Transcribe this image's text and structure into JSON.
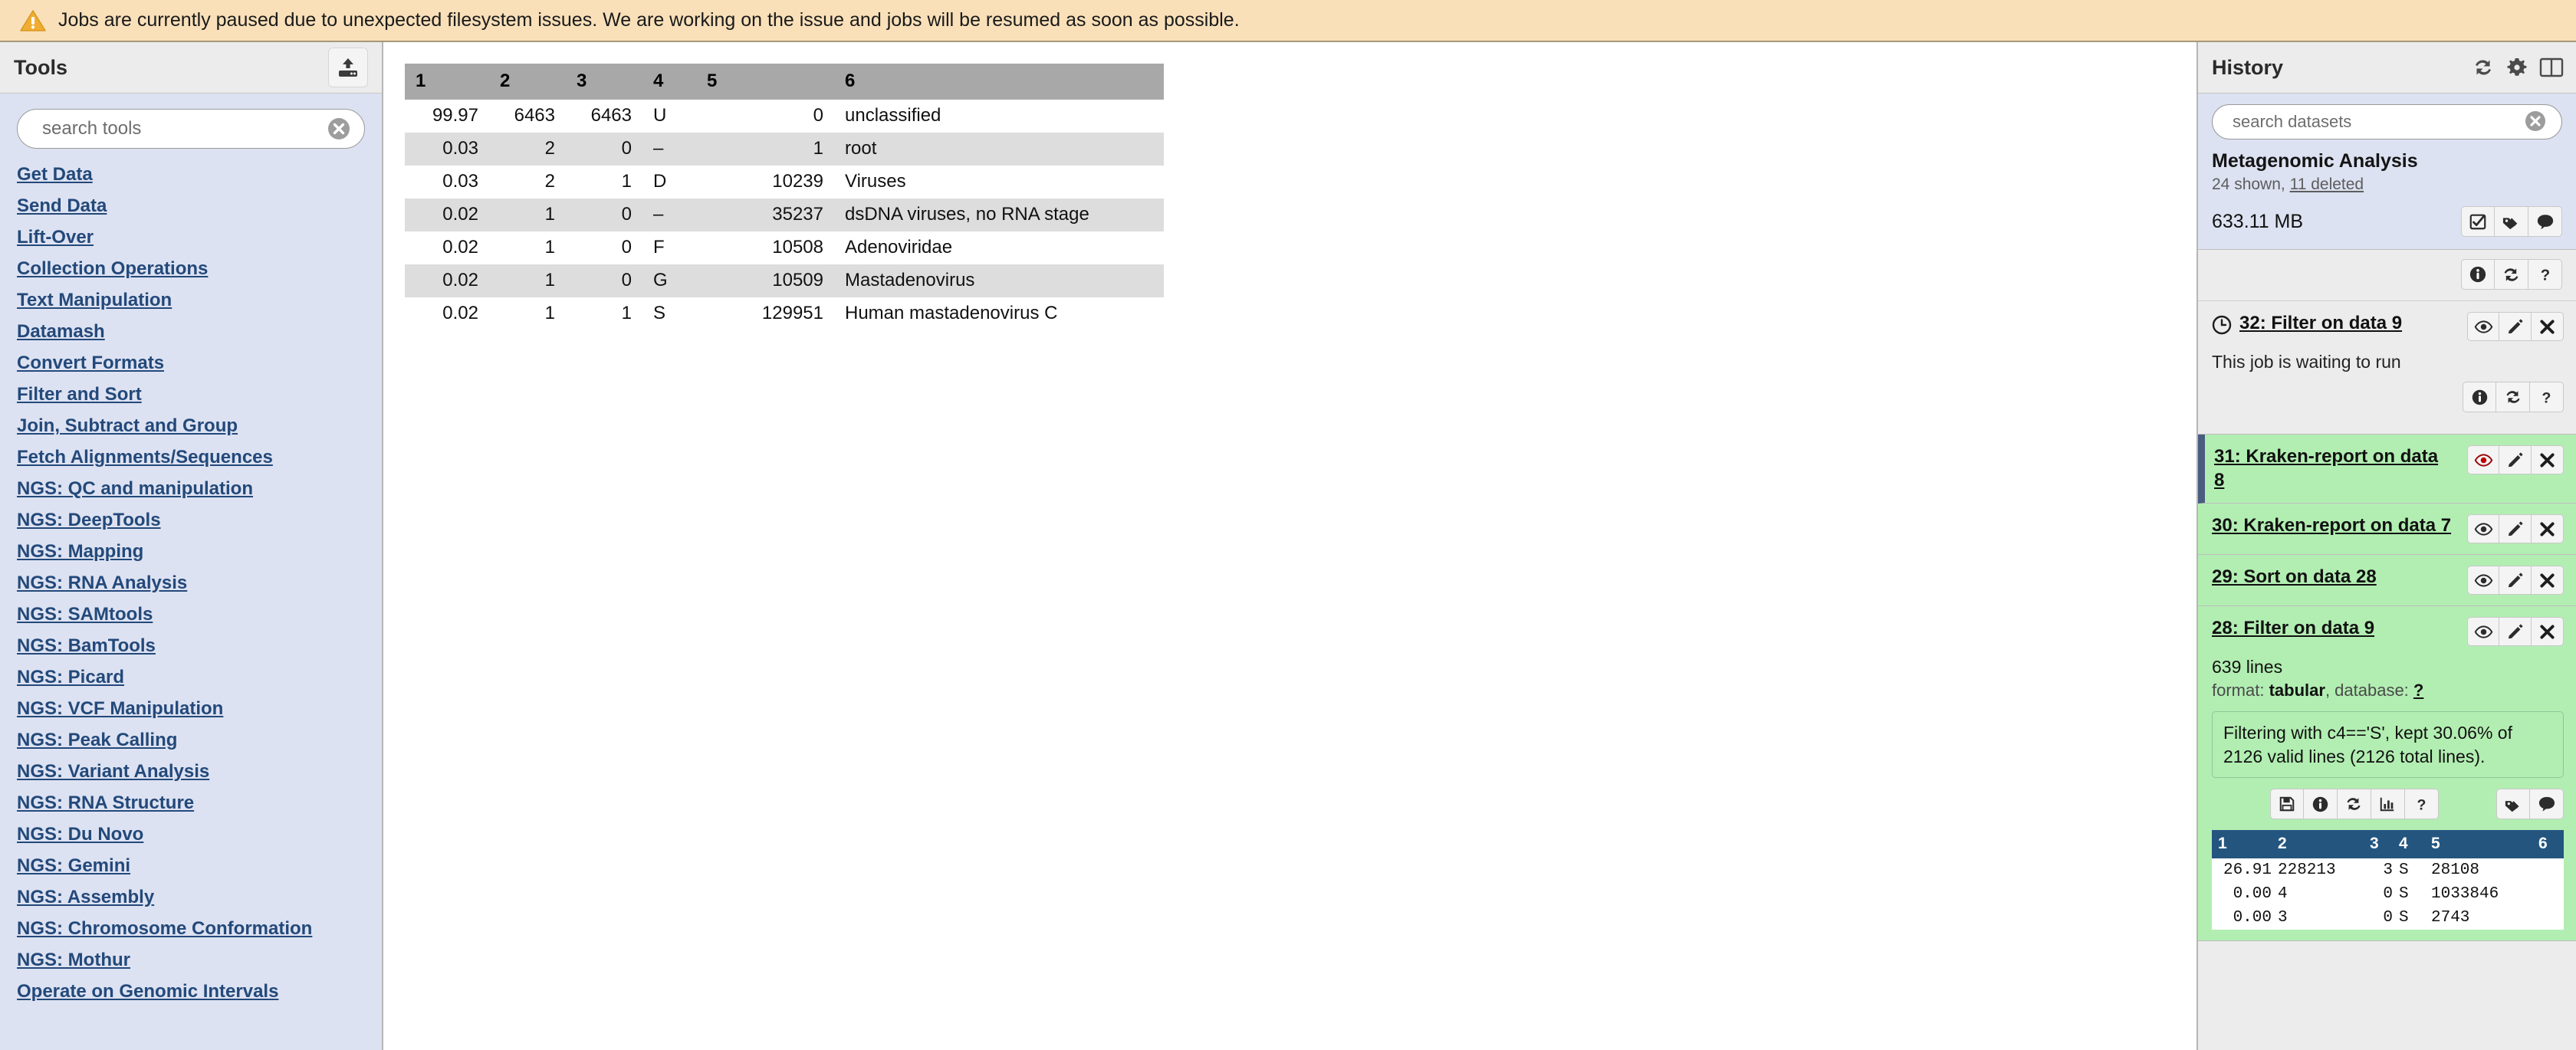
{
  "banner": {
    "icon": "warning-triangle-icon",
    "text": "Jobs are currently paused due to unexpected filesystem issues. We are working on the issue and jobs will be resumed as soon as possible."
  },
  "tools": {
    "title": "Tools",
    "upload_icon": "upload-icon",
    "search": {
      "placeholder": "search tools",
      "value": "",
      "clear_icon": "clear-circle-icon"
    },
    "items": [
      {
        "label": "Get Data"
      },
      {
        "label": "Send Data"
      },
      {
        "label": "Lift-Over"
      },
      {
        "label": "Collection Operations"
      },
      {
        "label": "Text Manipulation"
      },
      {
        "label": "Datamash"
      },
      {
        "label": "Convert Formats"
      },
      {
        "label": "Filter and Sort"
      },
      {
        "label": "Join, Subtract and Group"
      },
      {
        "label": "Fetch Alignments/Sequences"
      },
      {
        "label": "NGS: QC and manipulation"
      },
      {
        "label": "NGS: DeepTools"
      },
      {
        "label": "NGS: Mapping"
      },
      {
        "label": "NGS: RNA Analysis"
      },
      {
        "label": "NGS: SAMtools"
      },
      {
        "label": "NGS: BamTools"
      },
      {
        "label": "NGS: Picard"
      },
      {
        "label": "NGS: VCF Manipulation"
      },
      {
        "label": "NGS: Peak Calling"
      },
      {
        "label": "NGS: Variant Analysis"
      },
      {
        "label": "NGS: RNA Structure"
      },
      {
        "label": "NGS: Du Novo"
      },
      {
        "label": "NGS: Gemini"
      },
      {
        "label": "NGS: Assembly"
      },
      {
        "label": "NGS: Chromosome Conformation"
      },
      {
        "label": "NGS: Mothur"
      },
      {
        "label": "Operate on Genomic Intervals"
      }
    ]
  },
  "dataset": {
    "headers": [
      "1",
      "2",
      "3",
      "4",
      "5",
      "6"
    ],
    "rows": [
      [
        "99.97",
        "6463",
        "6463",
        "U",
        "0",
        "unclassified"
      ],
      [
        "0.03",
        "2",
        "0",
        "–",
        "1",
        "root"
      ],
      [
        "0.03",
        "2",
        "1",
        "D",
        "10239",
        "Viruses"
      ],
      [
        "0.02",
        "1",
        "0",
        "–",
        "35237",
        "dsDNA viruses, no RNA stage"
      ],
      [
        "0.02",
        "1",
        "0",
        "F",
        "10508",
        "Adenoviridae"
      ],
      [
        "0.02",
        "1",
        "0",
        "G",
        "10509",
        "Mastadenovirus"
      ],
      [
        "0.02",
        "1",
        "1",
        "S",
        "129951",
        "Human mastadenovirus C"
      ]
    ]
  },
  "history": {
    "title": "History",
    "header_icons": [
      "refresh-icon",
      "gear-icon",
      "split-columns-icon"
    ],
    "search": {
      "placeholder": "search datasets",
      "value": "",
      "clear_icon": "clear-circle-icon"
    },
    "name": "Metagenomic Analysis",
    "counts_shown": "24 shown, ",
    "counts_deleted": "11 deleted",
    "size": "633.11 MB",
    "summary_icons": [
      "select-checkbox-icon",
      "tags-icon",
      "annotation-icon"
    ],
    "toolbar_icons": [
      "info-icon",
      "refresh-icon",
      "help-icon"
    ],
    "items": [
      {
        "id": "32",
        "title": "32: Filter on data 9",
        "state": "queued",
        "selected": false,
        "has_clock": true,
        "status": "This job is waiting to run",
        "buttons": [
          "display-icon",
          "edit-icon",
          "delete-icon"
        ],
        "action_icons": [
          "info-icon",
          "refresh-icon",
          "help-icon"
        ]
      },
      {
        "id": "31",
        "title": "31: Kraken-report on data 8",
        "state": "ok",
        "selected": true,
        "has_clock": false,
        "buttons": [
          "display-icon",
          "edit-icon",
          "delete-icon"
        ],
        "display_active": true
      },
      {
        "id": "30",
        "title": "30: Kraken-report on data 7",
        "state": "ok",
        "selected": false,
        "has_clock": false,
        "buttons": [
          "display-icon",
          "edit-icon",
          "delete-icon"
        ]
      },
      {
        "id": "29",
        "title": "29: Sort on data 28",
        "state": "ok",
        "selected": false,
        "has_clock": false,
        "buttons": [
          "display-icon",
          "edit-icon",
          "delete-icon"
        ]
      },
      {
        "id": "28",
        "title": "28: Filter on data 9",
        "state": "ok",
        "selected": false,
        "expanded": true,
        "has_clock": false,
        "buttons": [
          "display-icon",
          "edit-icon",
          "delete-icon"
        ],
        "lines": "639 lines",
        "format_prefix": "format: ",
        "format_value": "tabular",
        "format_mid": ", database: ",
        "database_value": "?",
        "blurb": "Filtering with c4=='S', kept 30.06% of 2126 valid lines (2126 total lines).",
        "action_icons": [
          "save-icon",
          "info-icon",
          "refresh-icon",
          "chart-icon",
          "help-icon"
        ],
        "action_icons_right": [
          "tags-icon",
          "annotation-icon"
        ],
        "peek": {
          "headers": [
            "1",
            "2",
            "3",
            "4",
            "5",
            "6"
          ],
          "rows": [
            [
              "26.91",
              "228213",
              "3",
              "S",
              "28108",
              ""
            ],
            [
              "0.00",
              "4",
              "0",
              "S",
              "1033846",
              ""
            ],
            [
              "0.00",
              "3",
              "0",
              "S",
              "2743",
              ""
            ]
          ]
        }
      }
    ]
  }
}
